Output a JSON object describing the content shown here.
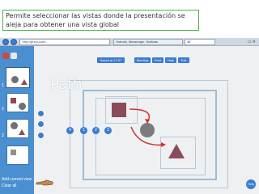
{
  "caption": {
    "text": "Permite seleccionar las vistas donde la presentación se aleja para obtener una vista global"
  },
  "browser": {
    "address": "http://prezi.com/...",
    "tabs": [
      {
        "label": "Hotmail, Messenger, Noticias"
      },
      {
        "label": "4E"
      }
    ]
  },
  "prezi": {
    "title": "Path",
    "toolbar": [
      {
        "label": "Saved at 17:07"
      },
      {
        "label": "Meeting"
      },
      {
        "label": "Print"
      },
      {
        "label": "Help"
      },
      {
        "label": "Exit"
      }
    ],
    "thumb_numbers": [
      "1",
      "2",
      "3"
    ],
    "path_steps": [
      "4",
      "1",
      "2",
      "3"
    ],
    "panel_actions": {
      "add": "Add current view",
      "clear": "Clear all"
    },
    "help": "Help"
  },
  "colors": {
    "caption_border": "#4bb04b",
    "panel": "#4a8fd0",
    "accent": "#3a7bd5",
    "shape_maroon": "#8a4c5a",
    "shape_gray": "#7b7b7b",
    "arrow_red": "#d0322d"
  }
}
